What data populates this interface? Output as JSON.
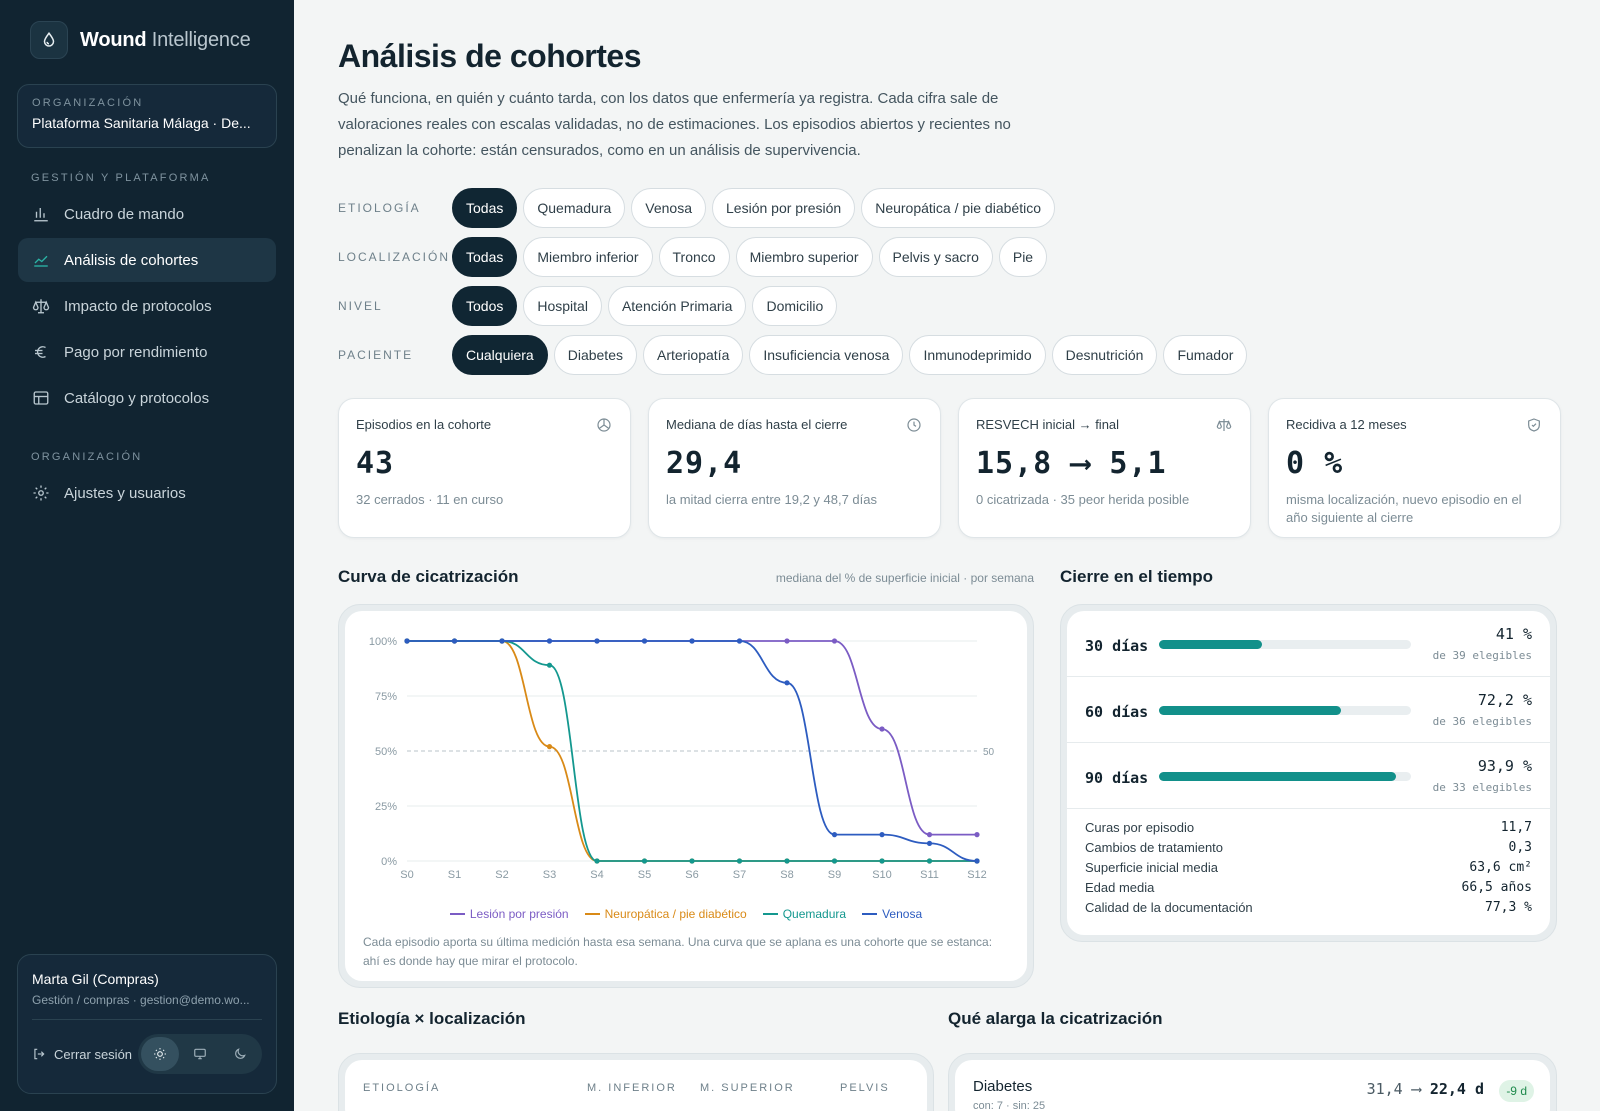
{
  "brand": {
    "name_bold": "Wound",
    "name_light": "Intelligence"
  },
  "org": {
    "label": "ORGANIZACIÓN",
    "name": "Plataforma Sanitaria Málaga · De..."
  },
  "nav": {
    "section_platform": "GESTIÓN Y PLATAFORMA",
    "section_org": "ORGANIZACIÓN",
    "items": [
      {
        "label": "Cuadro de mando",
        "icon": "bar-chart-icon"
      },
      {
        "label": "Análisis de cohortes",
        "icon": "trend-line-icon",
        "active": true
      },
      {
        "label": "Impacto de protocolos",
        "icon": "scale-icon"
      },
      {
        "label": "Pago por rendimiento",
        "icon": "euro-icon"
      },
      {
        "label": "Catálogo y protocolos",
        "icon": "table-icon"
      }
    ],
    "settings": {
      "label": "Ajustes y usuarios",
      "icon": "gear-icon"
    }
  },
  "user": {
    "name": "Marta Gil (Compras)",
    "role": "Gestión / compras · gestion@demo.wo...",
    "logout": "Cerrar sesión",
    "theme_options": [
      "sun-icon",
      "monitor-icon",
      "moon-icon"
    ]
  },
  "page": {
    "title": "Análisis de cohortes",
    "intro": "Qué funciona, en quién y cuánto tarda, con los datos que enfermería ya registra. Cada cifra sale de valoraciones reales con escalas validadas, no de estimaciones. Los episodios abiertos y recientes no penalizan la cohorte: están censurados, como en un análisis de supervivencia."
  },
  "filters": [
    {
      "label": "ETIOLOGÍA",
      "options": [
        "Todas",
        "Quemadura",
        "Venosa",
        "Lesión por presión",
        "Neuropática / pie diabético"
      ],
      "selected": 0
    },
    {
      "label": "LOCALIZACIÓN",
      "options": [
        "Todas",
        "Miembro inferior",
        "Tronco",
        "Miembro superior",
        "Pelvis y sacro",
        "Pie"
      ],
      "selected": 0
    },
    {
      "label": "NIVEL",
      "options": [
        "Todos",
        "Hospital",
        "Atención Primaria",
        "Domicilio"
      ],
      "selected": 0
    },
    {
      "label": "PACIENTE",
      "options": [
        "Cualquiera",
        "Diabetes",
        "Arteriopatía",
        "Insuficiencia venosa",
        "Inmunodeprimido",
        "Desnutrición",
        "Fumador"
      ],
      "selected": 0
    }
  ],
  "kpis": [
    {
      "label": "Episodios en la cohorte",
      "value": "43",
      "sub": "32 cerrados · 11 en curso",
      "icon": "pie-icon"
    },
    {
      "label": "Mediana de días hasta el cierre",
      "value": "29,4",
      "sub": "la mitad cierra entre 19,2 y 48,7 días",
      "icon": "clock-icon"
    },
    {
      "label": "RESVECH inicial → final",
      "value": "15,8 ⟶ 5,1",
      "sub": "0 cicatrizada · 35 peor herida posible",
      "icon": "scale-icon"
    },
    {
      "label": "Recidiva a 12 meses",
      "value": "0 %",
      "sub": "misma localización, nuevo episodio en el año siguiente al cierre",
      "icon": "shield-icon"
    }
  ],
  "healing": {
    "title": "Curva de cicatrización",
    "note": "mediana del % de superficie inicial · por semana",
    "caption": "Cada episodio aporta su última medición hasta esa semana. Una curva que se aplana es una cohorte que se estanca: ahí es donde hay que mirar el protocolo.",
    "threshold_label": "50"
  },
  "chart_data": {
    "type": "line",
    "x": [
      "S0",
      "S1",
      "S2",
      "S3",
      "S4",
      "S5",
      "S6",
      "S7",
      "S8",
      "S9",
      "S10",
      "S11",
      "S12"
    ],
    "y_ticks": [
      "0%",
      "25%",
      "50%",
      "75%",
      "100%"
    ],
    "ylim": [
      0,
      100
    ],
    "reference_line": 50,
    "grid": true,
    "legend_position": "bottom",
    "series": [
      {
        "name": "Lesión por presión",
        "color": "#7b5cc4",
        "values": [
          100,
          100,
          100,
          100,
          100,
          100,
          100,
          100,
          100,
          100,
          60,
          12,
          12
        ]
      },
      {
        "name": "Neuropática / pie diabético",
        "color": "#d98a17",
        "values": [
          100,
          100,
          100,
          52,
          0,
          0,
          0,
          0,
          0,
          0,
          0,
          0,
          0
        ]
      },
      {
        "name": "Quemadura",
        "color": "#14988f",
        "values": [
          100,
          100,
          100,
          89,
          0,
          0,
          0,
          0,
          0,
          0,
          0,
          0,
          0
        ]
      },
      {
        "name": "Venosa",
        "color": "#2d5cc0",
        "values": [
          100,
          100,
          100,
          100,
          100,
          100,
          100,
          100,
          81,
          12,
          12,
          8,
          0
        ]
      }
    ]
  },
  "closure": {
    "title": "Cierre en el tiempo",
    "rows": [
      {
        "days": "30 días",
        "pct": "41 %",
        "fraction": 0.41,
        "elig": "de 39 elegibles"
      },
      {
        "days": "60 días",
        "pct": "72,2 %",
        "fraction": 0.722,
        "elig": "de 36 elegibles"
      },
      {
        "days": "90 días",
        "pct": "93,9 %",
        "fraction": 0.939,
        "elig": "de 33 elegibles"
      }
    ],
    "stats": [
      {
        "label": "Curas por episodio",
        "value": "11,7"
      },
      {
        "label": "Cambios de tratamiento",
        "value": "0,3"
      },
      {
        "label": "Superficie inicial media",
        "value": "63,6 cm²"
      },
      {
        "label": "Edad media",
        "value": "66,5 años"
      },
      {
        "label": "Calidad de la documentación",
        "value": "77,3 %"
      }
    ]
  },
  "etiology_table": {
    "title": "Etiología × localización",
    "headers": [
      "ETIOLOGÍA",
      "M. INFERIOR",
      "M. SUPERIOR",
      "PELVIS"
    ]
  },
  "factors": {
    "title": "Qué alarga la cicatrización",
    "items": [
      {
        "name": "Diabetes",
        "sub": "con: 7 · sin: 25",
        "from": "31,4",
        "to": "22,4 d",
        "delta": "-9 d"
      }
    ]
  }
}
